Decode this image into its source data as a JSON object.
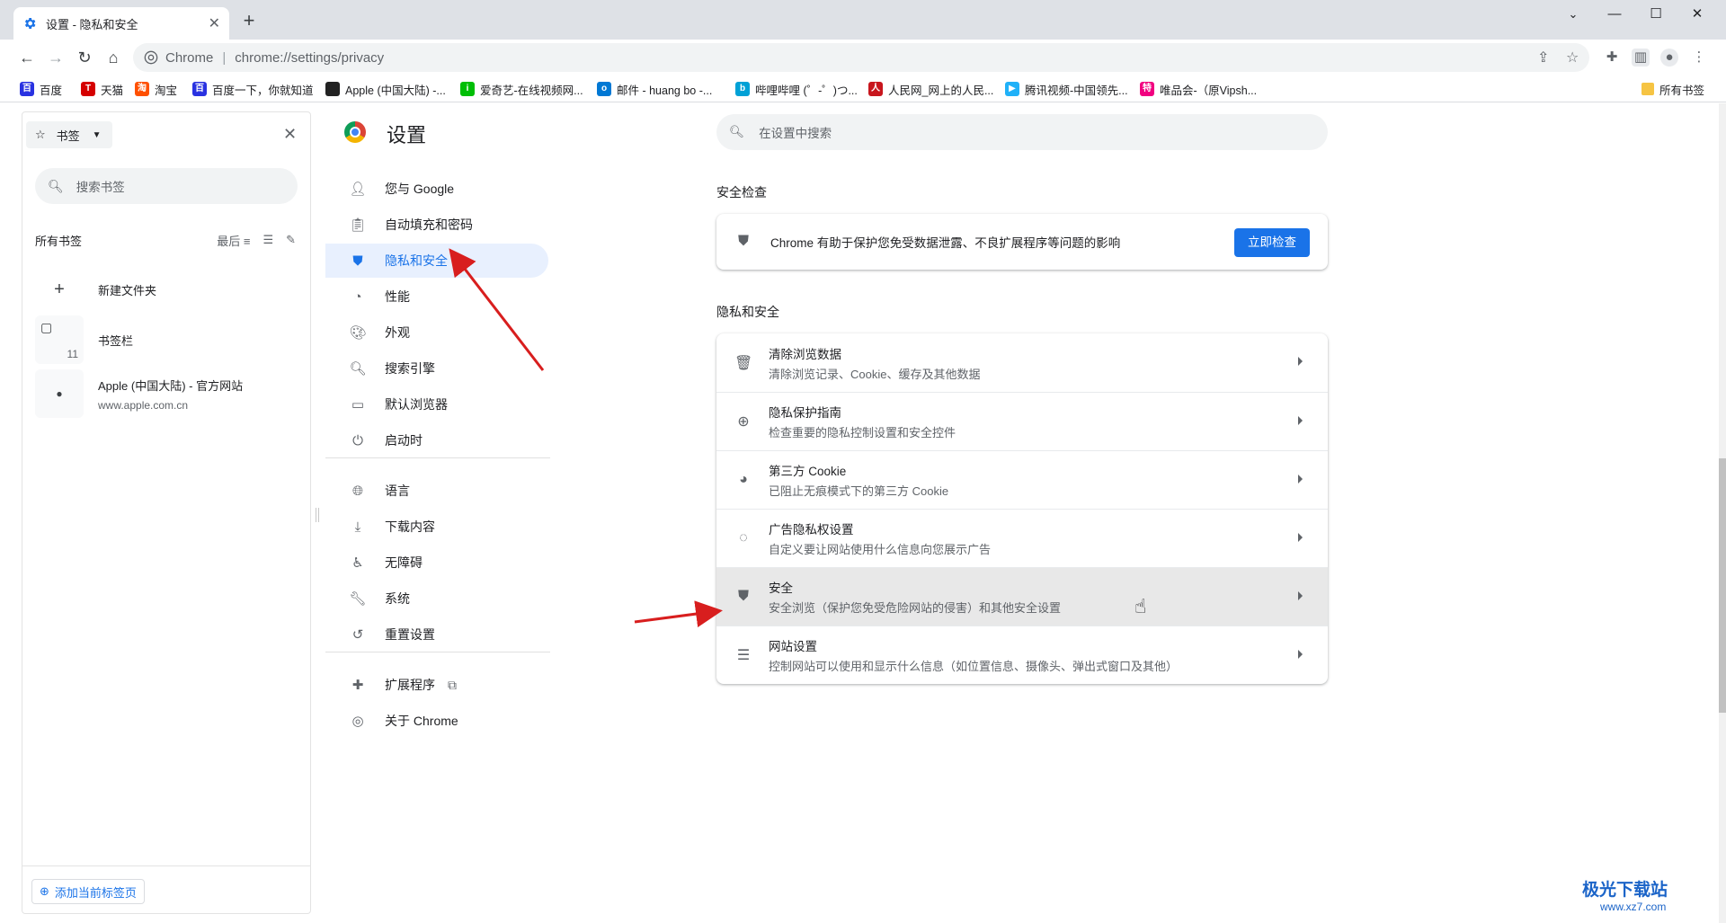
{
  "tab": {
    "title": "设置 - 隐私和安全",
    "close": "✕"
  },
  "new_tab": "+",
  "window": {
    "minimize": "—",
    "maximize": "☐",
    "close": "✕",
    "tabsearch": "⌄"
  },
  "toolbar": {
    "back": "←",
    "forward": "→",
    "reload": "↻",
    "home": "⌂"
  },
  "omnibox": {
    "site_label": "Chrome",
    "separator": "|",
    "url": "chrome://settings/privacy"
  },
  "bookmarks_bar": {
    "items": [
      {
        "label": "百度",
        "color": "#2932e1",
        "glyph": "百"
      },
      {
        "label": "天猫",
        "color": "#d50000",
        "glyph": "T"
      },
      {
        "label": "淘宝",
        "color": "#ff5000",
        "glyph": "淘"
      },
      {
        "label": "百度一下，你就知道",
        "color": "#2932e1",
        "glyph": "百"
      },
      {
        "label": "Apple (中国大陆) -...",
        "color": "#222222",
        "glyph": ""
      },
      {
        "label": "爱奇艺-在线视频网...",
        "color": "#00be06",
        "glyph": "i"
      },
      {
        "label": "邮件 - huang bo -...",
        "color": "#0078d4",
        "glyph": "o"
      },
      {
        "label": "哔哩哔哩 (゜-゜)つ...",
        "color": "#00a1d6",
        "glyph": "b"
      },
      {
        "label": "人民网_网上的人民...",
        "color": "#c8161d",
        "glyph": "人"
      },
      {
        "label": "腾讯视频-中国领先...",
        "color": "#20b1f8",
        "glyph": "▶"
      },
      {
        "label": "唯品会-（原Vipsh...",
        "color": "#f10180",
        "glyph": "特"
      }
    ],
    "all_bookmarks": "所有书签"
  },
  "side_panel": {
    "selector": "书签",
    "search_placeholder": "搜索书签",
    "all_bookmarks": "所有书签",
    "sort_label": "最后",
    "new_folder": "新建文件夹",
    "bookmark_bar": {
      "label": "书签栏",
      "count": "11"
    },
    "apple": {
      "title": "Apple (中国大陆) - 官方网站",
      "url": "www.apple.com.cn"
    },
    "add_current_tab": "添加当前标签页"
  },
  "settings": {
    "title": "设置",
    "search_placeholder": "在设置中搜索",
    "nav": [
      {
        "label": "您与 Google",
        "icon": "person-icon"
      },
      {
        "label": "自动填充和密码",
        "icon": "clipboard-icon"
      },
      {
        "label": "隐私和安全",
        "icon": "shield-icon",
        "active": true
      },
      {
        "label": "性能",
        "icon": "speedometer-icon"
      },
      {
        "label": "外观",
        "icon": "palette-icon"
      },
      {
        "label": "搜索引擎",
        "icon": "search-icon"
      },
      {
        "label": "默认浏览器",
        "icon": "browser-icon"
      },
      {
        "label": "启动时",
        "icon": "power-icon"
      },
      {
        "label": "语言",
        "icon": "globe-icon"
      },
      {
        "label": "下载内容",
        "icon": "download-icon"
      },
      {
        "label": "无障碍",
        "icon": "accessibility-icon"
      },
      {
        "label": "系统",
        "icon": "wrench-icon"
      },
      {
        "label": "重置设置",
        "icon": "history-icon"
      },
      {
        "label": "扩展程序",
        "icon": "puzzle-icon"
      },
      {
        "label": "关于 Chrome",
        "icon": "chrome-icon"
      }
    ],
    "safety_check": {
      "heading": "安全检查",
      "text": "Chrome 有助于保护您免受数据泄露、不良扩展程序等问题的影响",
      "button": "立即检查"
    },
    "privacy": {
      "heading": "隐私和安全",
      "rows": [
        {
          "title": "清除浏览数据",
          "subtitle": "清除浏览记录、Cookie、缓存及其他数据",
          "icon": "trash-icon"
        },
        {
          "title": "隐私保护指南",
          "subtitle": "检查重要的隐私控制设置和安全控件",
          "icon": "compass-icon"
        },
        {
          "title": "第三方 Cookie",
          "subtitle": "已阻止无痕模式下的第三方 Cookie",
          "icon": "cookie-icon"
        },
        {
          "title": "广告隐私权设置",
          "subtitle": "自定义要让网站使用什么信息向您展示广告",
          "icon": "ad-privacy-icon"
        },
        {
          "title": "安全",
          "subtitle": "安全浏览（保护您免受危险网站的侵害）和其他安全设置",
          "icon": "shield-icon",
          "hover": true
        },
        {
          "title": "网站设置",
          "subtitle": "控制网站可以使用和显示什么信息（如位置信息、摄像头、弹出式窗口及其他）",
          "icon": "sliders-icon"
        }
      ]
    }
  },
  "watermark": {
    "line1": "极光下载站",
    "line2": "www.xz7.com"
  },
  "colors": {
    "accent": "#1a73e8",
    "annotation_arrow": "#d81e1e"
  }
}
